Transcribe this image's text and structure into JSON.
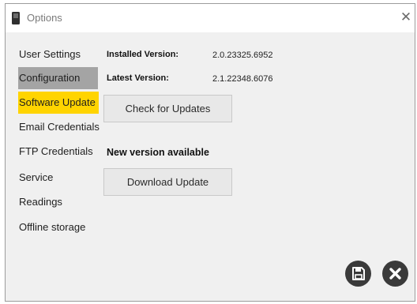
{
  "window": {
    "title": "Options",
    "close_glyph": "✕",
    "app_icon": "device-icon"
  },
  "sidebar": {
    "items": [
      {
        "label": "User Settings",
        "state": "normal"
      },
      {
        "label": "Configuration",
        "state": "active"
      },
      {
        "label": "Software Update",
        "state": "selected"
      },
      {
        "label": "Email Credentials",
        "state": "normal"
      },
      {
        "label": "FTP Credentials",
        "state": "normal"
      },
      {
        "label": "Service",
        "state": "normal"
      },
      {
        "label": "Readings",
        "state": "normal"
      },
      {
        "label": "Offline storage",
        "state": "normal"
      }
    ]
  },
  "update": {
    "installed_label": "Installed Version:",
    "installed_value": "2.0.23325.6952",
    "latest_label": "Latest Version:",
    "latest_value": "2.1.22348.6076",
    "check_button": "Check for Updates",
    "status_text": "New version available",
    "download_button": "Download Update"
  },
  "footer": {
    "save_icon": "save-icon",
    "close_icon": "close-icon"
  },
  "colors": {
    "selected": "#ffd400",
    "active": "#a4a4a4",
    "panel": "#f0f0f0",
    "round_button": "#3a3a3a"
  }
}
